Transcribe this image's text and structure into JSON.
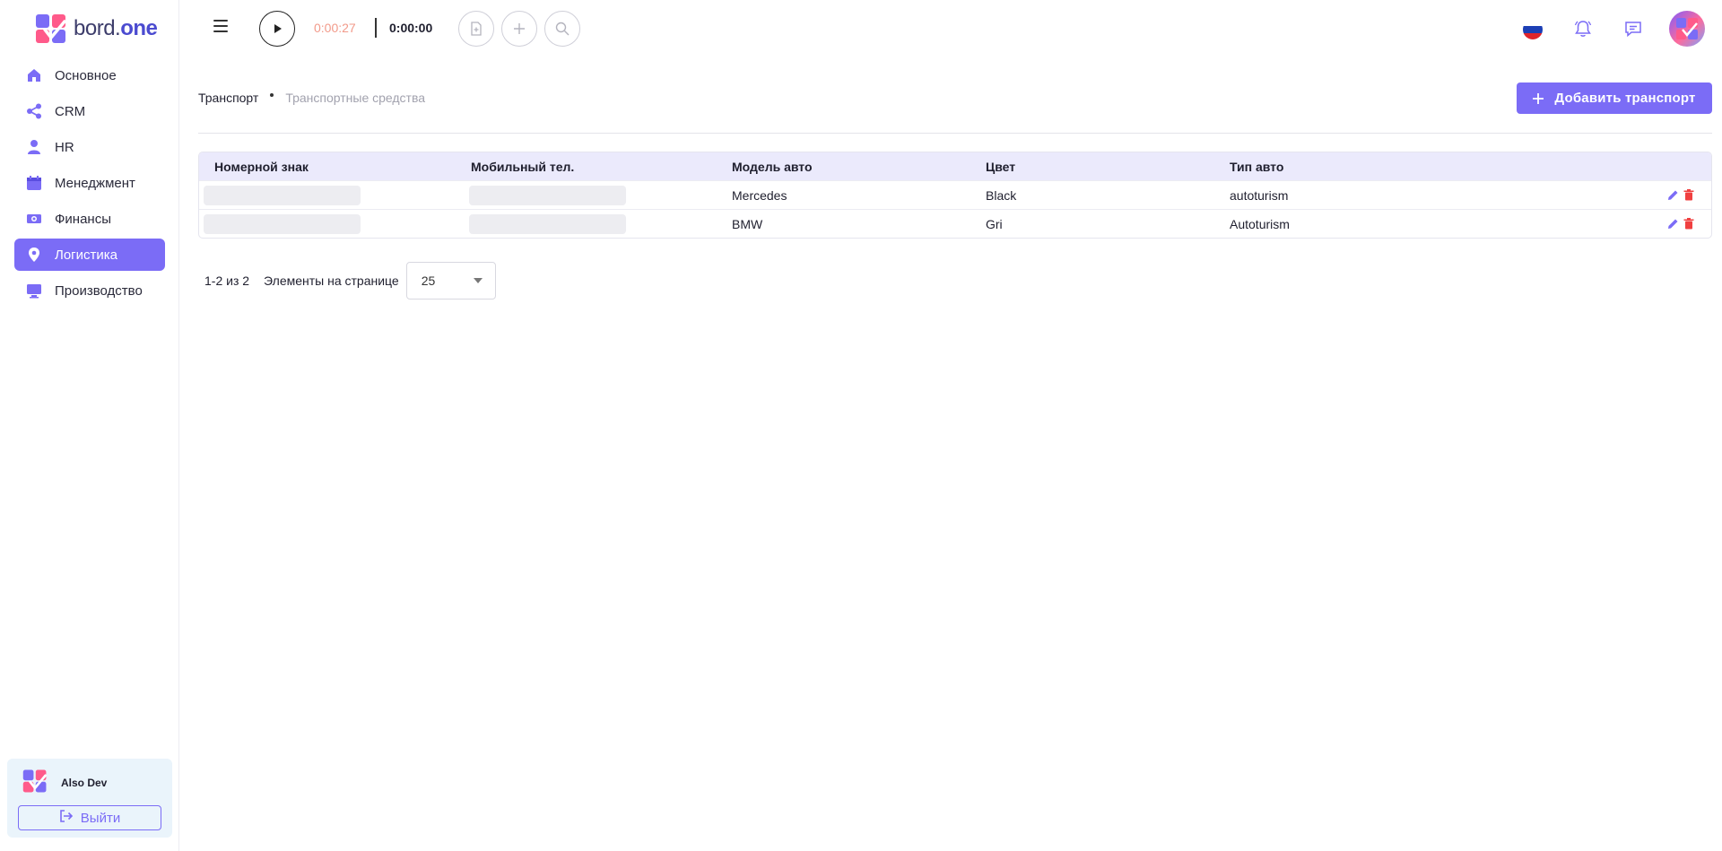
{
  "brand": {
    "name_plain": "bord.",
    "name_bold": "one",
    "colors": {
      "accent": "#7b6cf6",
      "pink": "#ff5a8a",
      "blue": "#4b8bff"
    }
  },
  "sidebar": {
    "items": [
      {
        "label": "Основное",
        "icon": "home-icon"
      },
      {
        "label": "CRM",
        "icon": "share-icon"
      },
      {
        "label": "HR",
        "icon": "person-icon"
      },
      {
        "label": "Менеджмент",
        "icon": "calendar-icon"
      },
      {
        "label": "Финансы",
        "icon": "money-icon"
      },
      {
        "label": "Логистика",
        "icon": "location-pin-icon",
        "active": true
      },
      {
        "label": "Производство",
        "icon": "monitor-icon"
      }
    ],
    "user": {
      "name": "Also Dev",
      "logout_label": "Выйти"
    }
  },
  "topbar": {
    "timer_running": "0:00:27",
    "timer_total": "0:00:00",
    "language": "ru"
  },
  "main": {
    "breadcrumb": {
      "parent": "Транспорт",
      "current": "Транспортные средства"
    },
    "add_button_label": "Добавить транспорт",
    "table": {
      "columns": [
        "Номерной знак",
        "Мобильный тел.",
        "Модель авто",
        "Цвет",
        "Тип авто"
      ],
      "rows": [
        {
          "plate": "",
          "phone": "",
          "model": "Mercedes",
          "color": "Black",
          "type": "autoturism"
        },
        {
          "plate": "",
          "phone": "",
          "model": "BMW",
          "color": "Gri",
          "type": "Autoturism"
        }
      ]
    },
    "pagination": {
      "range": "1-2 из 2",
      "per_page_label": "Элементы на странице",
      "per_page_value": "25"
    }
  }
}
